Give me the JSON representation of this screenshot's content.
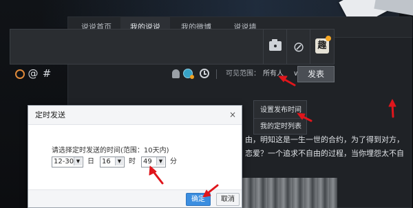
{
  "tabs": [
    "说说首页",
    "我的说说",
    "我的微博",
    "说说墙"
  ],
  "composer": {
    "icons": [
      "camera-icon",
      "link-icon",
      "qu-icon"
    ],
    "qu_label": "趣"
  },
  "toolbar": {
    "at": "@",
    "hash": "#",
    "visibility_label": "可见范围：",
    "visibility_value": "所有人",
    "visibility_caret": "∨",
    "publish": "发表"
  },
  "menu": {
    "items": [
      "设置发布时间",
      "我的定时列表"
    ]
  },
  "post": {
    "lines": [
      "由，明知这是一生一世的合约，为了得到对方，",
      "恋爱？一个追求不自由的过程，当你埋怨太不自"
    ]
  },
  "dialog": {
    "title": "定时发送",
    "close": "×",
    "prompt": "请选择定时发送的时间(范围：10天内)",
    "date": "12-30",
    "date_unit": "日",
    "hour": "16",
    "hour_unit": "时",
    "minute": "49",
    "minute_unit": "分",
    "ok": "确定",
    "cancel": "取消"
  },
  "colors": {
    "annotation": "#e0161c",
    "ok_button": "#3b8ee0"
  }
}
